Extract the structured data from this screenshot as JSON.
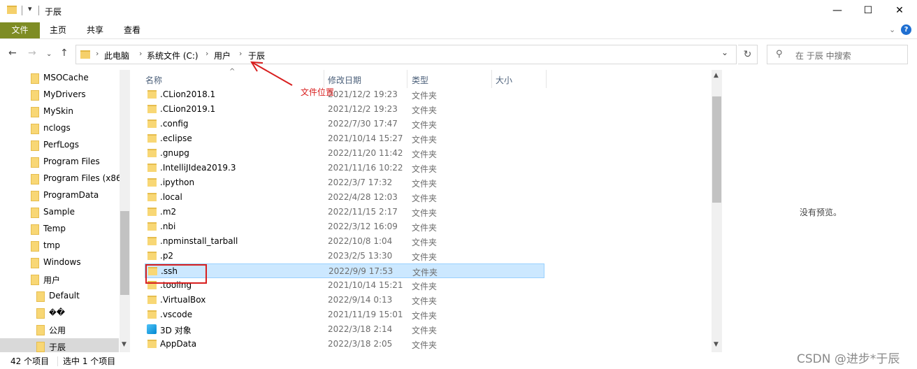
{
  "window": {
    "title": "于辰",
    "controls": {
      "minimize": "—",
      "maximize": "☐",
      "close": "✕"
    }
  },
  "ribbon": {
    "tabs": [
      "文件",
      "主页",
      "共享",
      "查看"
    ],
    "help": "?"
  },
  "address": {
    "crumbs": [
      "此电脑",
      "系统文件 (C:)",
      "用户",
      "于辰"
    ],
    "search_placeholder": "在 于辰 中搜索"
  },
  "nav_pane": {
    "items": [
      {
        "label": "MSOCache",
        "indent": 0
      },
      {
        "label": "MyDrivers",
        "indent": 0
      },
      {
        "label": "MySkin",
        "indent": 0
      },
      {
        "label": "nclogs",
        "indent": 0
      },
      {
        "label": "PerfLogs",
        "indent": 0
      },
      {
        "label": "Program Files",
        "indent": 0
      },
      {
        "label": "Program Files (x86",
        "indent": 0
      },
      {
        "label": "ProgramData",
        "indent": 0
      },
      {
        "label": "Sample",
        "indent": 0
      },
      {
        "label": "Temp",
        "indent": 0
      },
      {
        "label": "tmp",
        "indent": 0
      },
      {
        "label": "Windows",
        "indent": 0
      },
      {
        "label": "用户",
        "indent": 0
      },
      {
        "label": "Default",
        "indent": 1
      },
      {
        "label": "�ܿ�",
        "indent": 1
      },
      {
        "label": "公用",
        "indent": 1
      },
      {
        "label": "于辰",
        "indent": 1,
        "selected": true
      }
    ]
  },
  "file_list": {
    "columns": [
      "名称",
      "修改日期",
      "类型",
      "大小"
    ],
    "rows": [
      {
        "name": ".CLion2018.1",
        "date": "2021/12/2 19:23",
        "type": "文件夹"
      },
      {
        "name": ".CLion2019.1",
        "date": "2021/12/2 19:23",
        "type": "文件夹"
      },
      {
        "name": ".config",
        "date": "2022/7/30 17:47",
        "type": "文件夹"
      },
      {
        "name": ".eclipse",
        "date": "2021/10/14 15:27",
        "type": "文件夹"
      },
      {
        "name": ".gnupg",
        "date": "2022/11/20 11:42",
        "type": "文件夹"
      },
      {
        "name": ".IntelliJIdea2019.3",
        "date": "2021/11/16 10:22",
        "type": "文件夹"
      },
      {
        "name": ".ipython",
        "date": "2022/3/7 17:32",
        "type": "文件夹"
      },
      {
        "name": ".local",
        "date": "2022/4/28 12:03",
        "type": "文件夹"
      },
      {
        "name": ".m2",
        "date": "2022/11/15 2:17",
        "type": "文件夹"
      },
      {
        "name": ".nbi",
        "date": "2022/3/12 16:09",
        "type": "文件夹"
      },
      {
        "name": ".npminstall_tarball",
        "date": "2022/10/8 1:04",
        "type": "文件夹"
      },
      {
        "name": ".p2",
        "date": "2023/2/5 13:30",
        "type": "文件夹"
      },
      {
        "name": ".ssh",
        "date": "2022/9/9 17:53",
        "type": "文件夹",
        "selected": true
      },
      {
        "name": ".tooling",
        "date": "2021/10/14 15:21",
        "type": "文件夹"
      },
      {
        "name": ".VirtualBox",
        "date": "2022/9/14 0:13",
        "type": "文件夹"
      },
      {
        "name": ".vscode",
        "date": "2021/11/19 15:01",
        "type": "文件夹"
      },
      {
        "name": "3D 对象",
        "date": "2022/3/18 2:14",
        "type": "文件夹",
        "icon": "3d-objects-icon"
      },
      {
        "name": "AppData",
        "date": "2022/3/18 2:05",
        "type": "文件夹"
      }
    ]
  },
  "preview": {
    "text": "没有预览。"
  },
  "status": {
    "count": "42 个项目",
    "selected": "选中 1 个项目"
  },
  "annotation": {
    "label": "文件位置",
    "color": "#d81e1e"
  },
  "watermark": "CSDN @进步*于辰"
}
